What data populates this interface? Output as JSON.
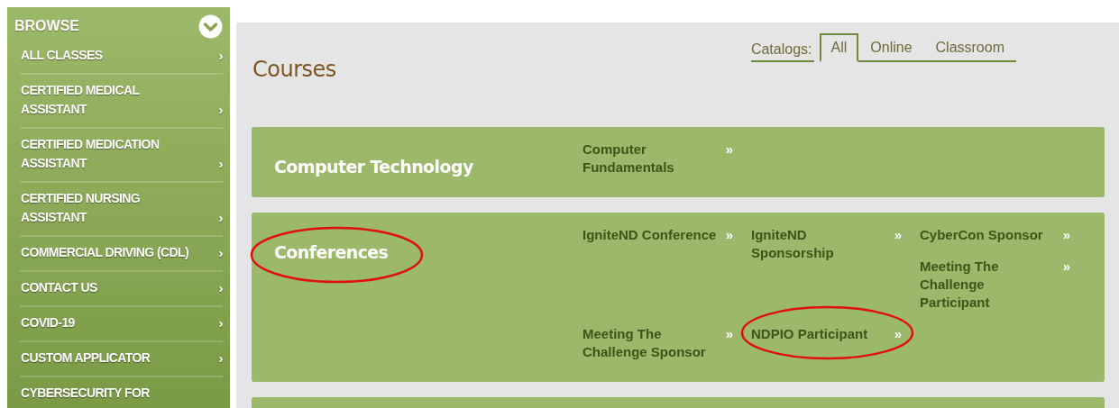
{
  "sidebar": {
    "title": "BROWSE",
    "items": [
      {
        "label": "ALL CLASSES",
        "arrow": "›"
      },
      {
        "label": "CERTIFIED MEDICAL ASSISTANT",
        "arrow": "›"
      },
      {
        "label": "CERTIFIED MEDICATION ASSISTANT",
        "arrow": "›"
      },
      {
        "label": "CERTIFIED NURSING ASSISTANT",
        "arrow": "›"
      },
      {
        "label": "COMMERCIAL DRIVING (CDL)",
        "arrow": "›"
      },
      {
        "label": "CONTACT US",
        "arrow": "›"
      },
      {
        "label": "COVID-19",
        "arrow": "›"
      },
      {
        "label": "CUSTOM APPLICATOR",
        "arrow": "›"
      },
      {
        "label": "CYBERSECURITY FOR"
      }
    ]
  },
  "heading": "Courses",
  "catalogs": {
    "label": "Catalogs:",
    "tabs": [
      {
        "label": "All",
        "selected": true
      },
      {
        "label": "Online",
        "selected": false
      },
      {
        "label": "Classroom",
        "selected": false
      }
    ]
  },
  "categories": [
    {
      "kind": "full",
      "title": "Computer Technology",
      "circled": false,
      "courses": [
        {
          "name": "Computer Fundamentals",
          "arrow": "»",
          "circled": false
        }
      ]
    },
    {
      "kind": "full",
      "title": "Conferences",
      "circled": true,
      "courses": [
        {
          "name": "IgniteND Conference",
          "arrow": "»",
          "circled": false
        },
        {
          "name": "IgniteND Sponsorship",
          "arrow": "»",
          "circled": false
        },
        {
          "name": "CyberCon Sponsor",
          "arrow": "»",
          "circled": false
        },
        {
          "name": "Meeting The Challenge Participant",
          "arrow": "»",
          "circled": false
        },
        {
          "name": "Meeting The Challenge Sponsor",
          "arrow": "»",
          "circled": false
        },
        {
          "name": "NDPIO Participant",
          "arrow": "»",
          "circled": true
        }
      ]
    },
    {
      "kind": "cut-off"
    }
  ]
}
